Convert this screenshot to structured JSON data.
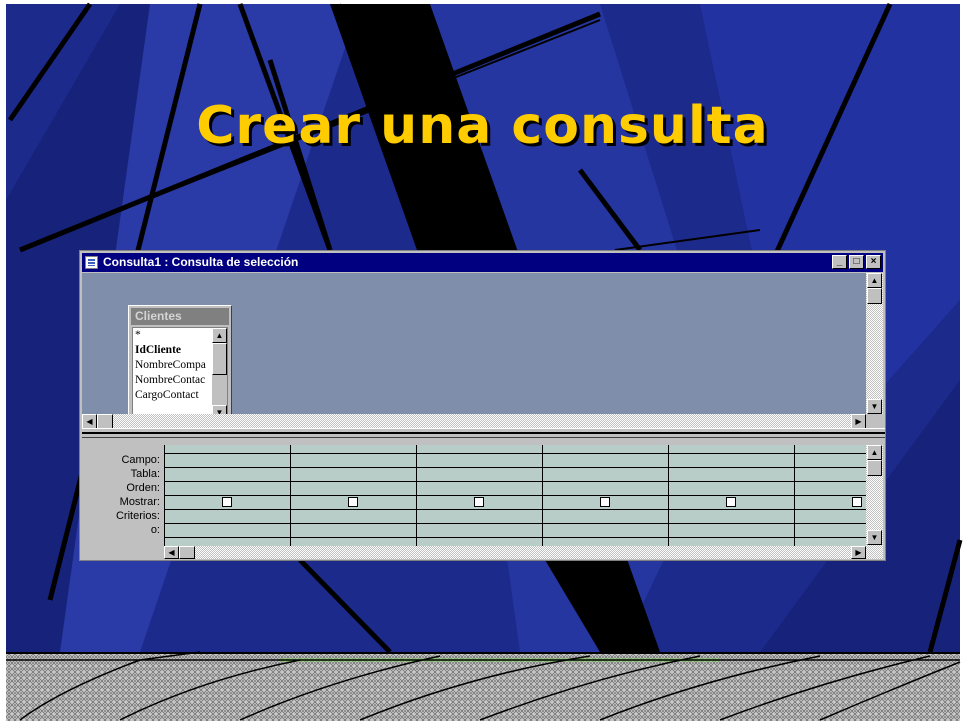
{
  "slide": {
    "title": "Crear una consulta"
  },
  "window": {
    "title": "Consulta1 : Consulta de selección",
    "controls": {
      "minimize": "_",
      "maximize": "□",
      "close": "×"
    }
  },
  "table_box": {
    "title": "Clientes",
    "fields": [
      "*",
      "IdCliente",
      "NombreCompa",
      "NombreContac",
      "CargoContact"
    ]
  },
  "grid": {
    "row_labels": [
      "Campo:",
      "Tabla:",
      "Orden:",
      "Mostrar:",
      "Criterios:",
      "o:"
    ],
    "columns": 6
  }
}
